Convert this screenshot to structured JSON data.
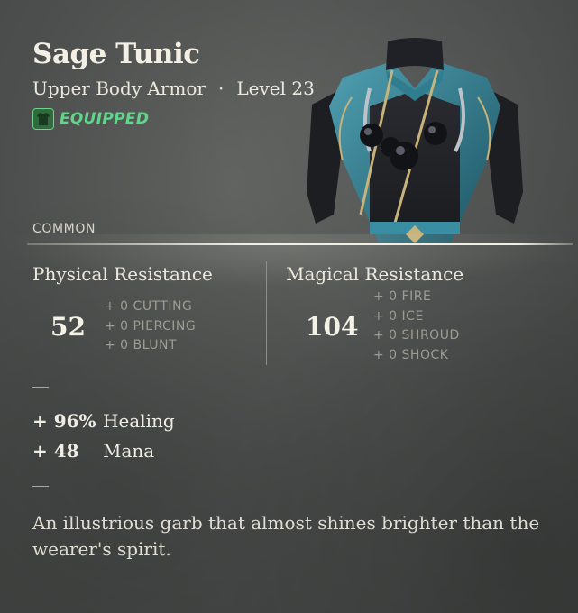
{
  "item": {
    "name": "Sage Tunic",
    "type": "Upper Body Armor",
    "separator": "·",
    "level": "Level 23",
    "equipped": "EQUIPPED",
    "rarity": "COMMON",
    "image_icon": "armor-tunic-image"
  },
  "resistances": {
    "physical": {
      "label": "Physical Resistance",
      "value": "52",
      "subs": [
        "+ 0  CUTTING",
        "+ 0  PIERCING",
        "+ 0  BLUNT"
      ]
    },
    "magical": {
      "label": "Magical Resistance",
      "value": "104",
      "subs": [
        "+ 0  FIRE",
        "+ 0  ICE",
        "+ 0  SHROUD",
        "+ 0  SHOCK"
      ]
    }
  },
  "bonuses": [
    {
      "value": "+ 96%",
      "label": "Healing"
    },
    {
      "value": "+ 48",
      "label": "Mana"
    }
  ],
  "description": "An illustrious garb that almost shines brighter than the wearer's spirit.",
  "colors": {
    "equipped": "#63d48c",
    "background": "#4c4f4d",
    "text": "#e9e6dc"
  }
}
